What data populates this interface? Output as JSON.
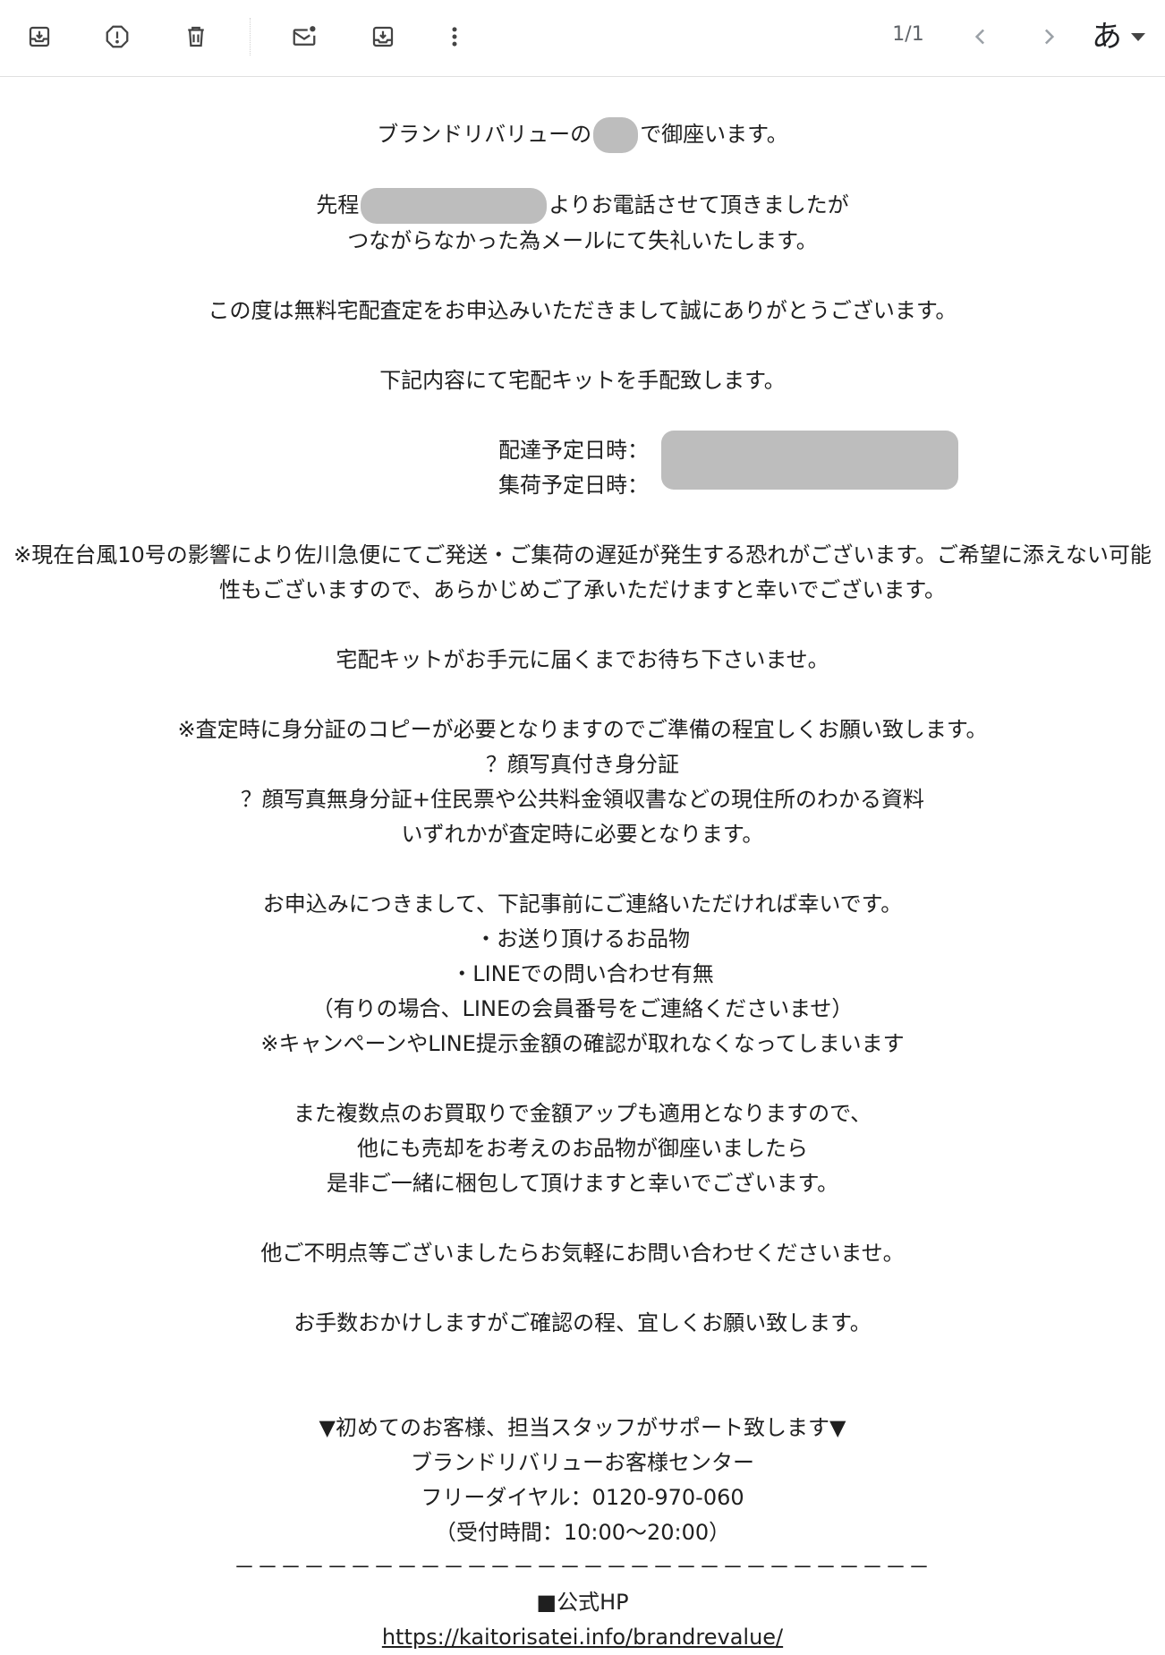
{
  "toolbar": {
    "buttons": [
      {
        "icon": "archive-icon",
        "label": "Archive"
      },
      {
        "icon": "report-spam-icon",
        "label": "Report spam"
      },
      {
        "icon": "delete-icon",
        "label": "Delete"
      },
      {
        "icon": "mark-unread-icon",
        "label": "Mark as unread"
      },
      {
        "icon": "move-to-icon",
        "label": "Move to"
      },
      {
        "icon": "more-vert-icon",
        "label": "More"
      }
    ],
    "pager": "1/1",
    "prev_icon": "chevron-left-icon",
    "next_icon": "chevron-right-icon",
    "input_tool": "あ"
  },
  "email": {
    "greeting_a": "ブランドリバリューの",
    "greeting_b": "で御座います。",
    "call_a": "先程",
    "call_b": "よりお電話させて頂きましたが",
    "call_c": "つながらなかった為メールにて失礼いたします。",
    "thanks": "この度は無料宅配査定をお申込みいただきまして誠にありがとうございます。",
    "kit": "下記内容にて宅配キットを手配致します。",
    "delivery_label": "配達予定日時：",
    "pickup_label": "集荷予定日時：",
    "typhoon": "※現在台風10号の影響により佐川急便にてご発送・ご集荷の遅延が発生する恐れがございます。ご希望に添えない可能性もございますので、あらかじめご了承いただけますと幸いでございます。",
    "wait": "宅配キットがお手元に届くまでお待ち下さいませ。",
    "id_note": "※査定時に身分証のコピーが必要となりますのでご準備の程宜しくお願い致します。",
    "id_opt1": "？顔写真付き身分証",
    "id_opt2": "？顔写真無身分証+住民票や公共料金領収書などの現住所のわかる資料",
    "id_either": "いずれかが査定時に必要となります。",
    "contact_req": "お申込みにつきまして、下記事前にご連絡いただければ幸いです。",
    "contact_item1": "・お送り頂けるお品物",
    "contact_item2": "・LINEでの問い合わせ有無",
    "contact_item3": "（有りの場合、LINEの会員番号をご連絡くださいませ）",
    "contact_item4": "※キャンペーンやLINE提示金額の確認が取れなくなってしまいます",
    "multi1": "また複数点のお買取りで金額アップも適用となりますので、",
    "multi2": "他にも売却をお考えのお品物が御座いましたら",
    "multi3": "是非ご一緒に梱包して頂けますと幸いでございます。",
    "questions": "他ご不明点等ございましたらお気軽にお問い合わせくださいませ。",
    "closing": "お手数おかけしますがご確認の程、宜しくお願い致します。",
    "support": "▼初めてのお客様、担当スタッフがサポート致します▼",
    "center": "ブランドリバリューお客様センター",
    "freedial": "フリーダイヤル：0120-970-060",
    "hours": "（受付時間：10:00〜20:00）",
    "divider": "－－－－－－－－－－－－－－－－－－－－－－－－－－－－－－",
    "hp_label": "■公式HP",
    "hp_url": "https://kaitorisatei.info/brandrevalue/"
  }
}
